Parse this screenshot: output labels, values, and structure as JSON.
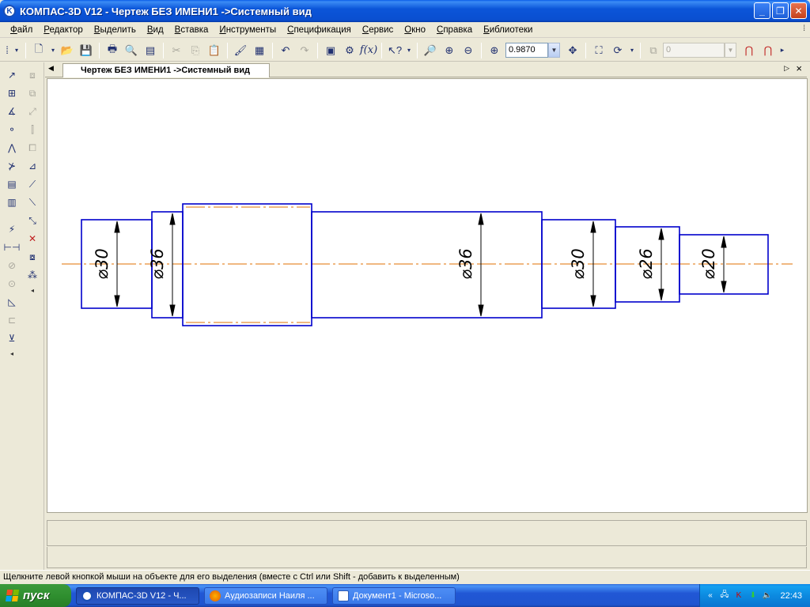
{
  "window": {
    "title": "КОМПАС-3D V12 - Чертеж БЕЗ ИМЕНИ1 ->Системный вид",
    "app_icon": "kompas-logo-icon"
  },
  "menu": [
    "Файл",
    "Редактор",
    "Выделить",
    "Вид",
    "Вставка",
    "Инструменты",
    "Спецификация",
    "Сервис",
    "Окно",
    "Справка",
    "Библиотеки"
  ],
  "toolbar": {
    "zoom_value": "0.9870",
    "layer_value": "0"
  },
  "document_tab": {
    "label": "Чертеж БЕЗ ИМЕНИ1 ->Системный вид"
  },
  "drawing": {
    "dimensions": [
      "⌀30",
      "⌀36",
      "⌀36",
      "⌀30",
      "⌀26",
      "⌀20"
    ],
    "colors": {
      "contour": "#0000cc",
      "axis": "#e07000",
      "dimension": "#000000"
    }
  },
  "status": {
    "hint": "Щелкните левой кнопкой мыши на объекте для его выделения (вместе с Ctrl или Shift - добавить к выделенным)"
  },
  "taskbar": {
    "start_label": "пуск",
    "tasks": [
      {
        "label": "КОМПАС-3D V12 - Ч...",
        "icon": "kompas-icon",
        "active": true
      },
      {
        "label": "Аудиозаписи Наиля ...",
        "icon": "firefox-icon",
        "active": false
      },
      {
        "label": "Документ1 - Microso...",
        "icon": "word-icon",
        "active": false
      }
    ],
    "clock": "22:43"
  }
}
